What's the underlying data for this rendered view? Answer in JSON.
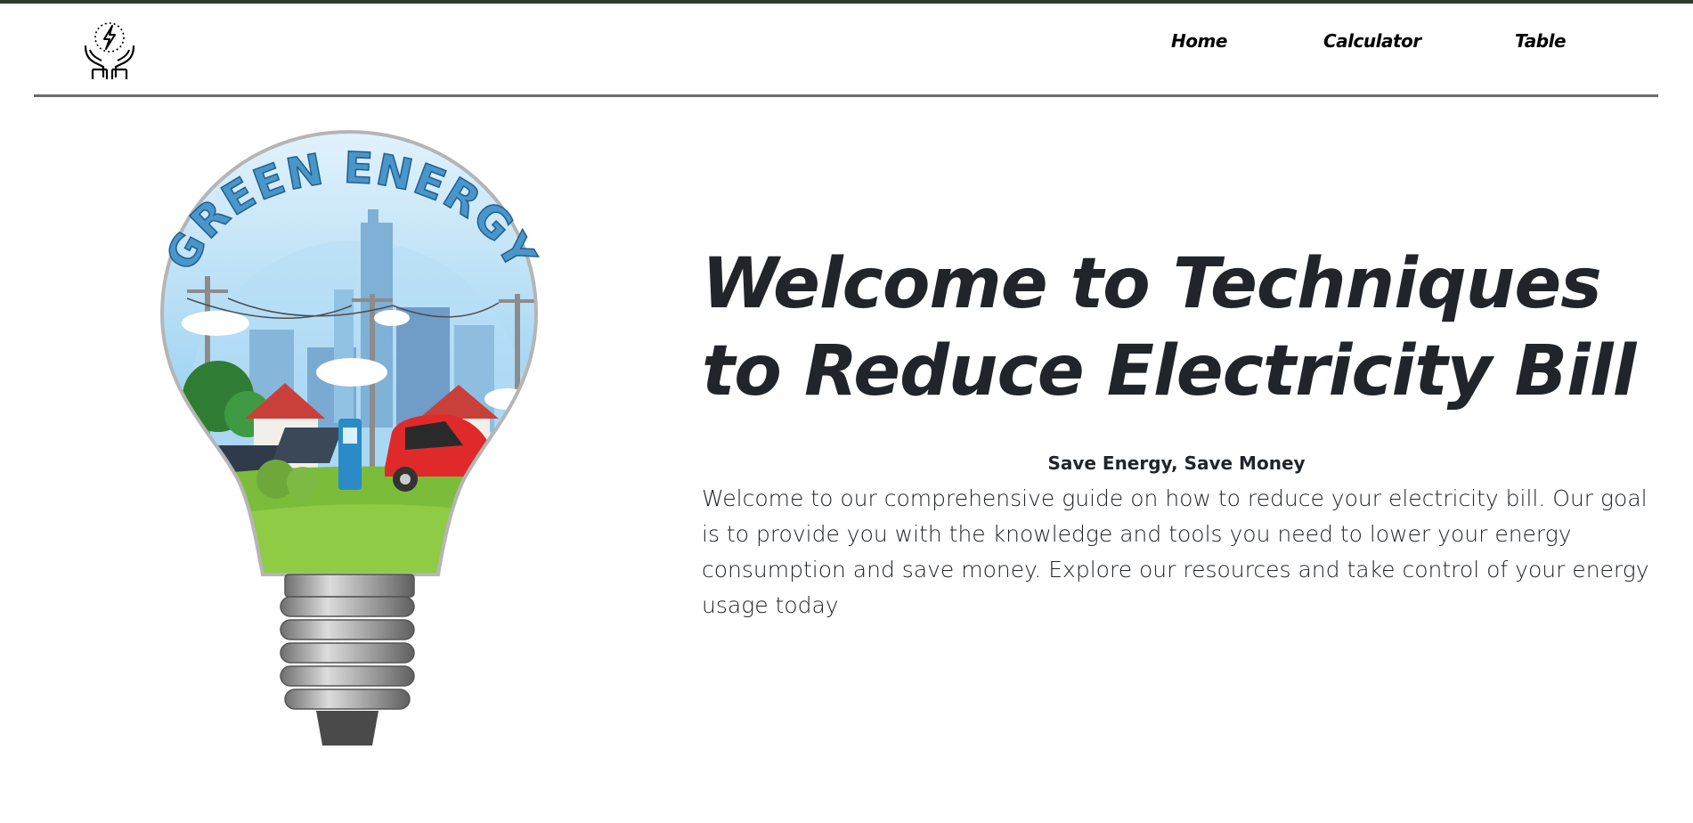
{
  "colors": {
    "top_strip": "#2d3a2b",
    "divider": "#6b6b6b",
    "text": "#212529",
    "bulb_sky": "#8ec9ee",
    "bulb_grass": "#7bbd3a",
    "car_red": "#e02a2a"
  },
  "nav": {
    "logo_icon": "hands-with-lightning-icon",
    "links": [
      {
        "label": "Home"
      },
      {
        "label": "Calculator"
      },
      {
        "label": "Table"
      }
    ]
  },
  "hero": {
    "illustration": {
      "name": "green-energy-lightbulb-illustration",
      "curved_text": "GREEN ENERGY"
    },
    "title": "Welcome to Techniques to Reduce Electricity Bill",
    "tagline": "Save Energy, Save Money",
    "body": "Welcome to our comprehensive guide on how to reduce your electricity bill. Our goal is to provide you with the knowledge and tools you need to lower your energy consumption and save money. Explore our resources and take control of your energy usage today"
  }
}
